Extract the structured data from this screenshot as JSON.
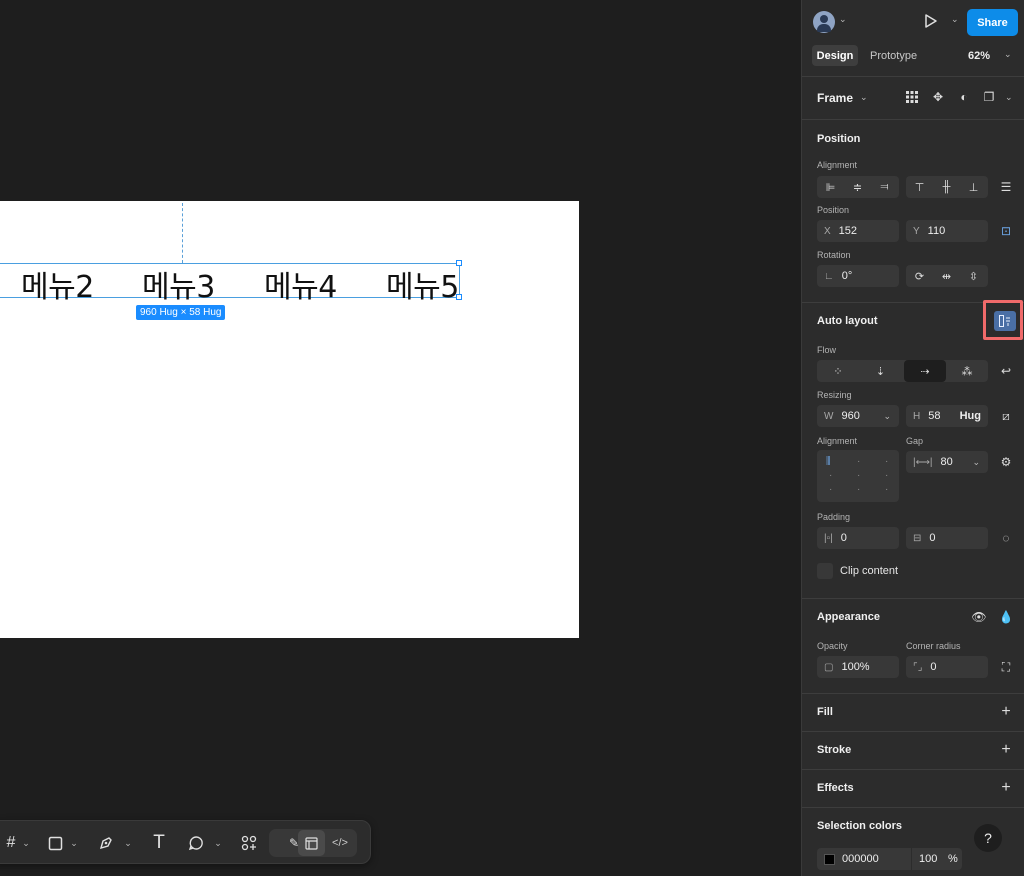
{
  "canvas": {
    "menus": [
      "메뉴2",
      "메뉴3",
      "메뉴4",
      "메뉴5"
    ],
    "size_badge": "960 Hug × 58 Hug"
  },
  "toolbar": {
    "items": [
      "frame-tool",
      "rectangle-tool",
      "pen-tool",
      "text-tool",
      "comment-tool",
      "actions-tool",
      "draw-mode",
      "design-mode",
      "dev-mode"
    ]
  },
  "header": {
    "share_label": "Share",
    "tab_design": "Design",
    "tab_prototype": "Prototype",
    "zoom": "62%"
  },
  "frame_section": {
    "title": "Frame"
  },
  "position": {
    "title": "Position",
    "alignment_label": "Alignment",
    "position_label": "Position",
    "x_prefix": "X",
    "x": "152",
    "y_prefix": "Y",
    "y": "110",
    "rotation_label": "Rotation",
    "rotation": "0°"
  },
  "auto_layout": {
    "title": "Auto layout",
    "flow_label": "Flow",
    "resizing_label": "Resizing",
    "w_prefix": "W",
    "w": "960",
    "h_prefix": "H",
    "h": "58",
    "h_mode": "Hug",
    "alignment_label": "Alignment",
    "gap_label": "Gap",
    "gap": "80",
    "padding_label": "Padding",
    "padding_h": "0",
    "padding_v": "0",
    "clip_label": "Clip content"
  },
  "appearance": {
    "title": "Appearance",
    "opacity_label": "Opacity",
    "opacity": "100%",
    "corner_label": "Corner radius",
    "corner": "0"
  },
  "fill": {
    "title": "Fill"
  },
  "stroke": {
    "title": "Stroke"
  },
  "effects": {
    "title": "Effects"
  },
  "selection_colors": {
    "title": "Selection colors",
    "hex": "000000",
    "opacity": "100",
    "percent": "%"
  },
  "colors": {
    "accent": "#0d8ce9",
    "highlight": "#f06a6a",
    "panel": "#2c2c2c",
    "canvas": "#1e1e1e"
  }
}
